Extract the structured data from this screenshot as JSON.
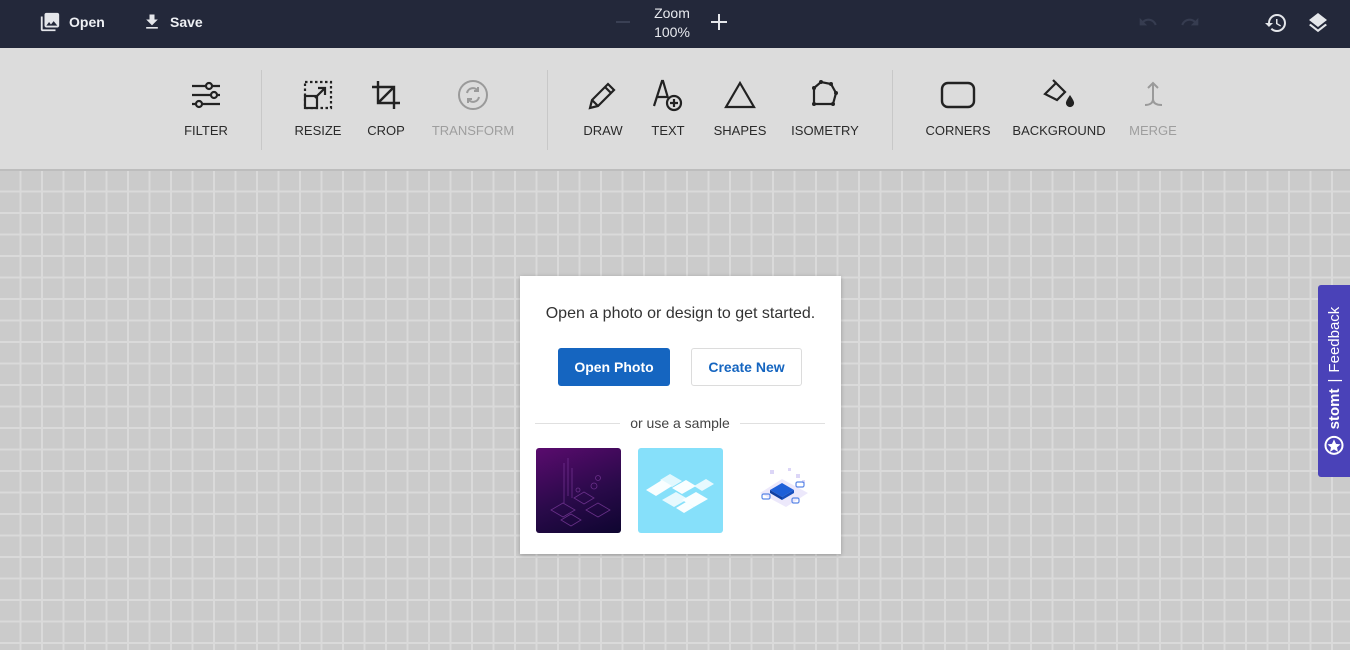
{
  "topbar": {
    "open_label": "Open",
    "save_label": "Save",
    "zoom_title": "Zoom",
    "zoom_value": "100%",
    "icons": {
      "open": "photo-library-icon",
      "save": "download-icon",
      "zoom_out": "minus-icon",
      "zoom_in": "plus-icon",
      "undo": "undo-icon",
      "redo": "redo-icon",
      "history": "history-icon",
      "layers": "layers-icon"
    }
  },
  "toolbar": {
    "tools": [
      {
        "id": "filter",
        "label": "FILTER",
        "icon": "sliders-icon",
        "enabled": true
      },
      {
        "id": "resize",
        "label": "RESIZE",
        "icon": "resize-icon",
        "enabled": true
      },
      {
        "id": "crop",
        "label": "CROP",
        "icon": "crop-icon",
        "enabled": true
      },
      {
        "id": "transform",
        "label": "TRANSFORM",
        "icon": "rotate-icon",
        "enabled": false
      },
      {
        "id": "draw",
        "label": "DRAW",
        "icon": "pencil-icon",
        "enabled": true
      },
      {
        "id": "text",
        "label": "TEXT",
        "icon": "text-add-icon",
        "enabled": true
      },
      {
        "id": "shapes",
        "label": "SHAPES",
        "icon": "triangle-icon",
        "enabled": true
      },
      {
        "id": "isometry",
        "label": "ISOMETRY",
        "icon": "polygon-icon",
        "enabled": true
      },
      {
        "id": "corners",
        "label": "CORNERS",
        "icon": "rounded-rect-icon",
        "enabled": true
      },
      {
        "id": "background",
        "label": "BACKGROUND",
        "icon": "paint-bucket-icon",
        "enabled": true
      },
      {
        "id": "merge",
        "label": "MERGE",
        "icon": "merge-icon",
        "enabled": false
      }
    ]
  },
  "card": {
    "title": "Open a photo or design to get started.",
    "open_photo_label": "Open Photo",
    "create_new_label": "Create New",
    "divider_text": "or use a sample",
    "samples": [
      {
        "name": "purple-circuit-sample"
      },
      {
        "name": "cyan-isometric-sample"
      },
      {
        "name": "blue-chip-sample"
      }
    ]
  },
  "feedback": {
    "brand": "stomt",
    "separator": "|",
    "label": "Feedback"
  },
  "colors": {
    "topbar_bg": "#23283a",
    "toolbar_bg": "#dcdcdc",
    "primary": "#1565c0",
    "feedback_bg": "#4a42b8"
  }
}
